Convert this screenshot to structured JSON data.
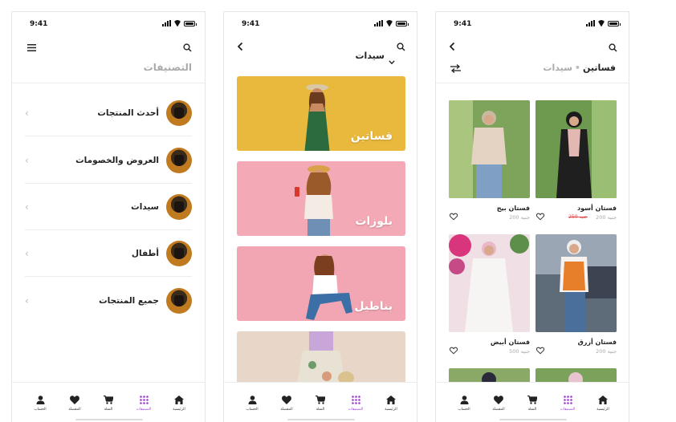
{
  "status_time": "9:41",
  "screen1": {
    "title": "التصنيفات",
    "categories": [
      {
        "label": "أحدث المنتجات"
      },
      {
        "label": "العروض والخصومات"
      },
      {
        "label": "سيدات"
      },
      {
        "label": "أطفال"
      },
      {
        "label": "جميع المنتجات"
      }
    ]
  },
  "screen2": {
    "title": "سيدات",
    "banners": [
      {
        "label": "فساتين",
        "color": "#e9b93e"
      },
      {
        "label": "بلوزات",
        "color": "#f3a9b6"
      },
      {
        "label": "بناطيل",
        "color": "#f2a6b3"
      },
      {
        "label": "",
        "color": "#e8d6c8"
      }
    ]
  },
  "screen3": {
    "breadcrumb_parent": "سيدات",
    "breadcrumb_current": "فساتين",
    "products": [
      {
        "name": "فستان أسود",
        "price": "200 جنيه",
        "old_price": "250 جنيه"
      },
      {
        "name": "فستان بيج",
        "price": "200 جنيه"
      },
      {
        "name": "فستان أزرق",
        "price": "200 جنيه"
      },
      {
        "name": "فستان أبيض",
        "price": "500 جنيه"
      }
    ]
  },
  "nav": {
    "home": "الرئيسية",
    "categories": "التصنيفات",
    "cart": "السلة",
    "favorites": "المفضلة",
    "account": "الحساب"
  },
  "colors": {
    "accent": "#9b3fd0",
    "text": "#222222",
    "muted": "#aaaaaa"
  }
}
